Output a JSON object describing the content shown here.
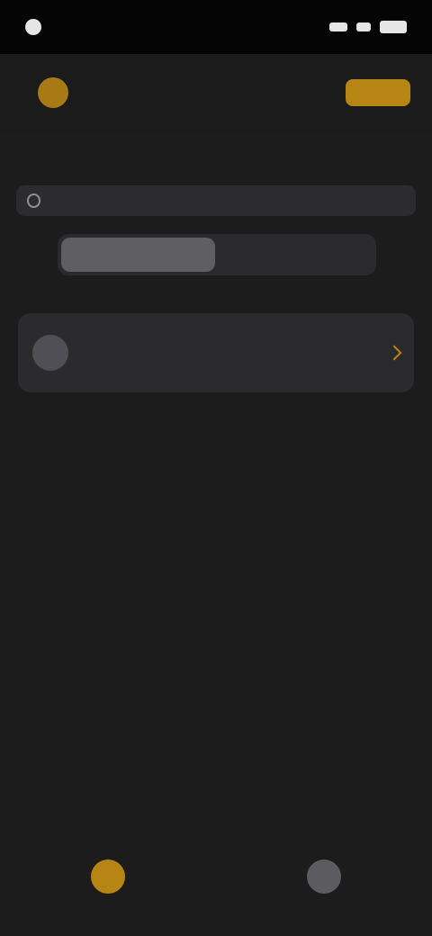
{
  "colors": {
    "accent": "#b78514",
    "background": "#1c1c1d",
    "card": "#2b2b2e",
    "status_bar": "#050505"
  },
  "status_bar": {
    "time": "",
    "icons": [
      "back-indicator-icon",
      "signal-icon",
      "wifi-icon",
      "battery-icon"
    ]
  },
  "top_bar": {
    "left_icon": "gear-icon",
    "action_label": ""
  },
  "page": {
    "title": ""
  },
  "search": {
    "placeholder": ""
  },
  "segmented": {
    "options": [
      "",
      ""
    ],
    "selected_index": 0
  },
  "list": {
    "items": [
      {
        "title": "",
        "subtitle": "",
        "icon": "avatar-icon"
      }
    ]
  },
  "tabbar": {
    "tabs": [
      {
        "label": "",
        "icon": "home-icon",
        "active": true
      },
      {
        "label": "",
        "icon": "person-icon",
        "active": false
      }
    ]
  }
}
